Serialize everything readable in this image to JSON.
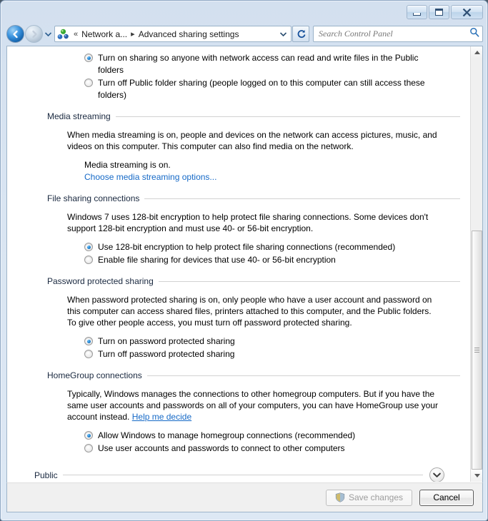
{
  "window": {
    "controls": {
      "minimize": "Minimize",
      "restore": "Restore",
      "close": "Close"
    }
  },
  "navbar": {
    "back_label": "Back",
    "forward_label": "Forward",
    "recent_pages_label": "Recent pages",
    "overflow_chevrons": "«",
    "crumb1": "Network a...",
    "crumb_sep": "▸",
    "crumb2": "Advanced sharing settings",
    "address_dropdown_label": "Previous locations",
    "refresh_label": "Refresh",
    "search_placeholder": "Search Control Panel",
    "search_value": ""
  },
  "sections": [
    {
      "id": "public-folder-sharing",
      "options": [
        {
          "label": "Turn on sharing so anyone with network access can read and write files in the Public folders",
          "selected": true
        },
        {
          "label": "Turn off Public folder sharing (people logged on to this computer can still access these folders)",
          "selected": false
        }
      ]
    },
    {
      "id": "media-streaming",
      "heading": "Media streaming",
      "paragraph": "When media streaming is on, people and devices on the network can access pictures, music, and videos on this computer. This computer can also find media on the network.",
      "status": "Media streaming is on.",
      "link": "Choose media streaming options..."
    },
    {
      "id": "file-sharing-connections",
      "heading": "File sharing connections",
      "paragraph": "Windows 7 uses 128-bit encryption to help protect file sharing connections. Some devices don't support 128-bit encryption and must use 40- or 56-bit encryption.",
      "options": [
        {
          "label": "Use 128-bit encryption to help protect file sharing connections (recommended)",
          "selected": true
        },
        {
          "label": "Enable file sharing for devices that use 40- or 56-bit encryption",
          "selected": false
        }
      ]
    },
    {
      "id": "password-protected-sharing",
      "heading": "Password protected sharing",
      "paragraph": "When password protected sharing is on, only people who have a user account and password on this computer can access shared files, printers attached to this computer, and the Public folders. To give other people access, you must turn off password protected sharing.",
      "options": [
        {
          "label": "Turn on password protected sharing",
          "selected": true
        },
        {
          "label": "Turn off password protected sharing",
          "selected": false
        }
      ]
    },
    {
      "id": "homegroup-connections",
      "heading": "HomeGroup connections",
      "paragraph_before": "Typically, Windows manages the connections to other homegroup computers. But if you have the same user accounts and passwords on all of your computers, you can have HomeGroup use your account instead. ",
      "link": "Help me decide",
      "options": [
        {
          "label": "Allow Windows to manage homegroup connections (recommended)",
          "selected": true
        },
        {
          "label": "Use user accounts and passwords to connect to other computers",
          "selected": false
        }
      ]
    }
  ],
  "collapsed_section": {
    "heading": "Public",
    "expander_label": "Expand"
  },
  "footer": {
    "save_label": "Save changes",
    "save_disabled": true,
    "cancel_label": "Cancel"
  },
  "scrollbar": {
    "up_label": "Scroll up",
    "down_label": "Scroll down"
  },
  "colors": {
    "link": "#1569c7",
    "heading": "#19283f",
    "radio_dot": "#2a8edb",
    "frame": "#d9e5f2"
  }
}
